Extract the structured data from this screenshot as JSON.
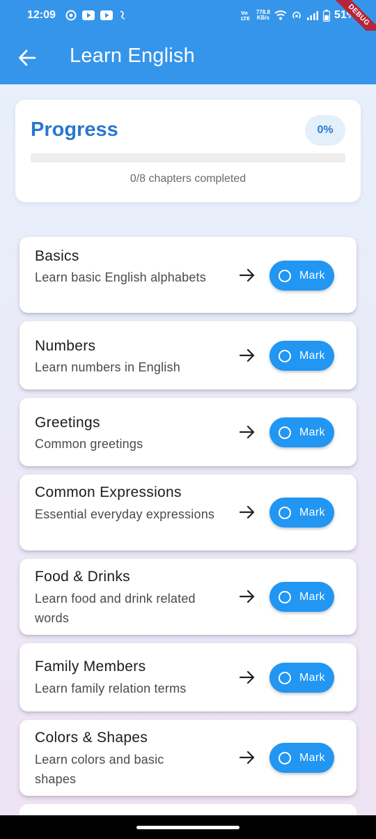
{
  "status_bar": {
    "time": "12:09",
    "volte": "Vo))\nLTE",
    "net_speed_value": "778.8",
    "net_speed_unit": "KB/s",
    "battery": "51%",
    "debug_label": "DEBUG"
  },
  "app_bar": {
    "title": "Learn English",
    "color": "#3595ea"
  },
  "progress": {
    "title": "Progress",
    "percent_label": "0%",
    "fraction": 0,
    "caption": "0/8 chapters completed"
  },
  "chapters": [
    {
      "title": "Basics",
      "description": "Learn basic English alphabets",
      "mark_label": "Mark"
    },
    {
      "title": "Numbers",
      "description": "Learn numbers in English",
      "mark_label": "Mark"
    },
    {
      "title": "Greetings",
      "description": "Common greetings",
      "mark_label": "Mark"
    },
    {
      "title": "Common Expressions",
      "description": "Essential everyday expressions",
      "mark_label": "Mark"
    },
    {
      "title": "Food & Drinks",
      "description": "Learn food and drink related words",
      "mark_label": "Mark"
    },
    {
      "title": "Family Members",
      "description": "Learn family relation terms",
      "mark_label": "Mark"
    },
    {
      "title": "Colors & Shapes",
      "description": "Learn colors and basic shapes",
      "mark_label": "Mark"
    }
  ],
  "icons": {
    "back": "arrow-left-icon",
    "chapter_open": "arrow-right-icon",
    "mark": "circle-outline-icon"
  }
}
